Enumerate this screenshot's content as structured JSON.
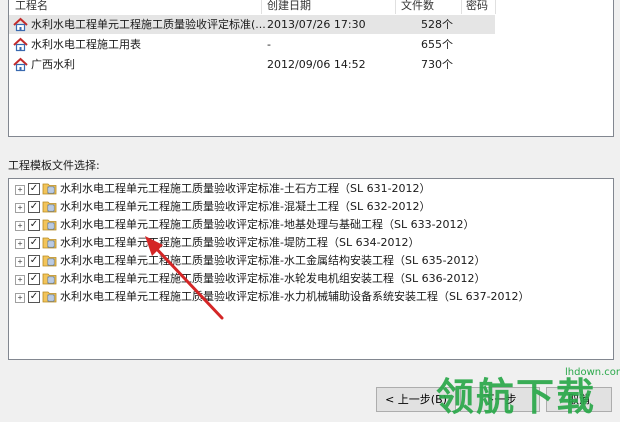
{
  "project_list": {
    "headers": [
      "工程名",
      "创建日期",
      "文件数",
      "密码"
    ],
    "rows": [
      {
        "name": "水利水电工程单元工程施工质量验收评定标准(...",
        "date": "2013/07/26 17:30",
        "count": "528个",
        "selected": true
      },
      {
        "name": "水利水电工程施工用表",
        "date": "-",
        "count": "655个",
        "selected": false
      },
      {
        "name": "广西水利",
        "date": "2012/09/06 14:52",
        "count": "730个",
        "selected": false
      }
    ]
  },
  "template_section": {
    "label": "工程模板文件选择:",
    "items": [
      {
        "label": "水利水电工程单元工程施工质量验收评定标准-土石方工程（SL 631-2012）",
        "checked": true
      },
      {
        "label": "水利水电工程单元工程施工质量验收评定标准-混凝土工程（SL 632-2012）",
        "checked": true
      },
      {
        "label": "水利水电工程单元工程施工质量验收评定标准-地基处理与基础工程（SL 633-2012）",
        "checked": true
      },
      {
        "label": "水利水电工程单元工程施工质量验收评定标准-堤防工程（SL 634-2012）",
        "checked": true
      },
      {
        "label": "水利水电工程单元工程施工质量验收评定标准-水工金属结构安装工程（SL 635-2012）",
        "checked": true
      },
      {
        "label": "水利水电工程单元工程施工质量验收评定标准-水轮发电机组安装工程（SL 636-2012）",
        "checked": true
      },
      {
        "label": "水利水电工程单元工程施工质量验收评定标准-水力机械辅助设备系统安装工程（SL 637-2012）",
        "checked": true
      }
    ]
  },
  "buttons": {
    "back": "< 上一步(B)",
    "next": "下一步",
    "cancel": "取消"
  },
  "watermark": {
    "site": "lhdown.com",
    "brand": "领航下载"
  },
  "icons": {
    "project": "house-icon",
    "template": "folder-doc-icon",
    "expand": "plus-expander-icon",
    "checkbox": "checkbox-checked-icon"
  },
  "colors": {
    "accent_red": "#d42020",
    "arrow_red": "#d42626",
    "watermark_green": "#2aa84a",
    "selection": "#e5e5e5"
  }
}
